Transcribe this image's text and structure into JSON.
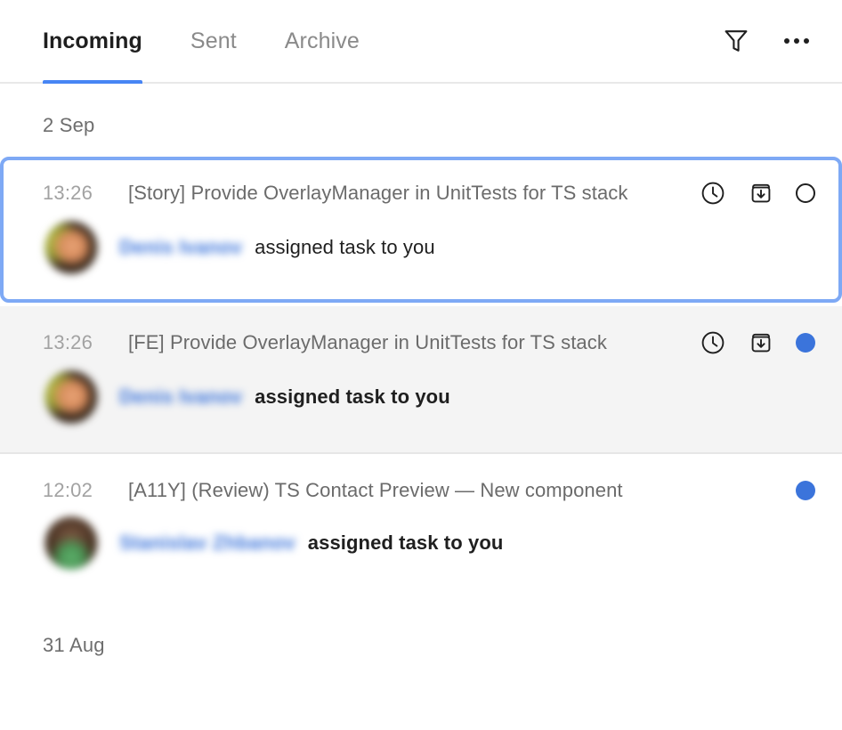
{
  "header": {
    "tabs": [
      {
        "label": "Incoming",
        "active": true
      },
      {
        "label": "Sent",
        "active": false
      },
      {
        "label": "Archive",
        "active": false
      }
    ],
    "filter_icon": "filter-funnel-icon",
    "more_icon": "more-horizontal-icon",
    "accent_color": "#4785f4",
    "active_tab_color": "#1f1f1f",
    "inactive_tab_color": "#8a8a8a"
  },
  "list": {
    "date_groups": [
      {
        "label": "2 Sep"
      },
      {
        "label": "31 Aug"
      }
    ],
    "items": [
      {
        "time": "13:26",
        "title": "[Story] Provide OverlayManager in UnitTests for TS stack",
        "author": "Denis Ivanov",
        "action": "assigned task to you",
        "state": "focused",
        "status": "read",
        "actions_visible": true,
        "snooze_icon": "clock-icon",
        "archive_icon": "archive-download-icon",
        "status_icon": "unread-circle-outline-icon"
      },
      {
        "time": "13:26",
        "title": "[FE] Provide OverlayManager in UnitTests for TS stack",
        "author": "Denis Ivanov",
        "action": "assigned task to you",
        "state": "hover",
        "status": "unread",
        "actions_visible": true,
        "snooze_icon": "clock-icon",
        "archive_icon": "archive-download-icon",
        "status_icon": "unread-dot-icon"
      },
      {
        "time": "12:02",
        "title": "[A11Y] (Review) TS Contact Preview — New component",
        "author": "Stanislav Zhbanov",
        "action": "assigned task to you",
        "state": "plain",
        "status": "unread",
        "actions_visible": false,
        "status_icon": "unread-dot-icon"
      }
    ],
    "colors": {
      "unread_dot": "#3b74db",
      "focus_ring": "#7ea9f5",
      "hover_background": "#f4f4f4",
      "title_text": "#6b6b6b",
      "time_text": "#a2a2a2",
      "author_text": "#3b74db",
      "action_text": "#1f1f1f",
      "date_text": "#6e6e6e"
    }
  }
}
